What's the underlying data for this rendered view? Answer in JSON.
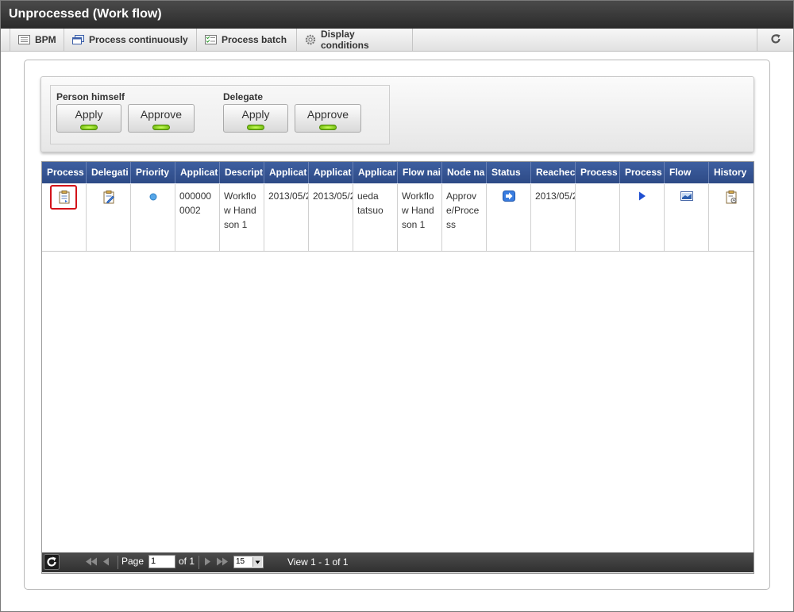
{
  "window": {
    "title": "Unprocessed (Work flow)"
  },
  "toolbar": {
    "items": [
      {
        "label": "BPM",
        "icon": "bpm-icon"
      },
      {
        "label": "Process continuously",
        "icon": "windows-icon"
      },
      {
        "label": "Process batch",
        "icon": "checklist-icon"
      },
      {
        "label": "Display conditions",
        "icon": "gear-icon"
      }
    ],
    "refresh_icon": "refresh-icon"
  },
  "actions": {
    "person_himself": {
      "label": "Person himself",
      "apply": "Apply",
      "approve": "Approve"
    },
    "delegate": {
      "label": "Delegate",
      "apply": "Apply",
      "approve": "Approve"
    }
  },
  "grid": {
    "columns": [
      "Process",
      "Delegati",
      "Priority",
      "Applicat",
      "Descript",
      "Applicat",
      "Applicat",
      "Applicar",
      "Flow nai",
      "Node na",
      "Status",
      "Reachec",
      "Process",
      "Process",
      "Flow",
      "History"
    ],
    "rows": [
      {
        "application_no": "0000000002",
        "description": "Workflow Handson 1",
        "applied_date": "2013/05/2",
        "apply_date2": "2013/05/2",
        "applicant": "ueda tatsuo",
        "flow_name": "Workflow Handson 1",
        "node_name": "Approve/Process",
        "reached": "2013/05/2",
        "process_extra": ""
      }
    ]
  },
  "pager": {
    "page_label": "Page",
    "page_value": "1",
    "of_label": "of 1",
    "rows_per_page": "15",
    "view_text": "View 1 - 1 of 1"
  },
  "colors": {
    "header_blue": "#2d4a86",
    "led_green": "#7fd000",
    "selected_red": "#d3131a"
  }
}
